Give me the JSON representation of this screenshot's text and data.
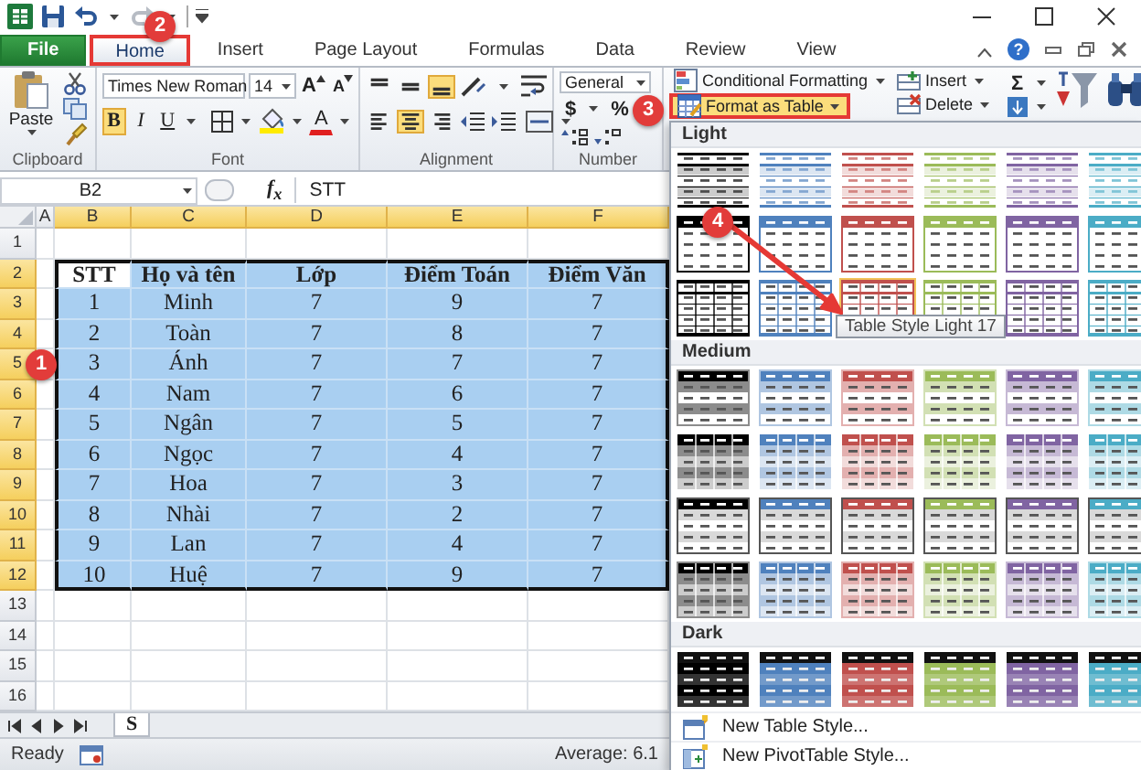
{
  "quick_access": [
    {
      "kind": "save",
      "disabled": false
    },
    {
      "kind": "undo",
      "disabled": false
    },
    {
      "kind": "redo",
      "disabled": true
    }
  ],
  "window": {
    "help": "?"
  },
  "tabs": [
    {
      "label": "File",
      "kind": "file",
      "selected": false,
      "highlighted": false
    },
    {
      "label": "Home",
      "kind": "tab",
      "selected": true,
      "highlighted": true
    },
    {
      "label": "Insert",
      "kind": "tab",
      "selected": false,
      "highlighted": false
    },
    {
      "label": "Page Layout",
      "kind": "tab",
      "selected": false,
      "highlighted": false
    },
    {
      "label": "Formulas",
      "kind": "tab",
      "selected": false,
      "highlighted": false
    },
    {
      "label": "Data",
      "kind": "tab",
      "selected": false,
      "highlighted": false
    },
    {
      "label": "Review",
      "kind": "tab",
      "selected": false,
      "highlighted": false
    },
    {
      "label": "View",
      "kind": "tab",
      "selected": false,
      "highlighted": false
    }
  ],
  "ribbon": {
    "clipboard": {
      "label": "Clipboard",
      "paste": "Paste"
    },
    "font": {
      "label": "Font",
      "font_name": "Times New Roman",
      "font_size": "14",
      "size_buttons": [
        {
          "label": "A",
          "kind": "grow"
        },
        {
          "label": "A",
          "kind": "shrink"
        }
      ],
      "styles": [
        {
          "label": "B",
          "kind": "bold",
          "selected": true
        },
        {
          "label": "I",
          "kind": "italic",
          "selected": false
        },
        {
          "label": "U",
          "kind": "underline",
          "selected": false
        }
      ],
      "font_color": "A"
    },
    "alignment": {
      "label": "Alignment",
      "vertical": [
        {
          "kind": "top",
          "selected": false
        },
        {
          "kind": "middle",
          "selected": false
        },
        {
          "kind": "bottom",
          "selected": true
        }
      ],
      "horizontal": [
        {
          "kind": "left",
          "selected": false
        },
        {
          "kind": "center",
          "selected": true
        },
        {
          "kind": "right",
          "selected": false
        }
      ]
    },
    "number": {
      "label": "Number",
      "format": "General",
      "currency": "$",
      "percent": "%"
    },
    "styles": {
      "buttons": [
        {
          "label": "Conditional Formatting",
          "kind": "conditional",
          "open": false,
          "highlighted": false
        },
        {
          "label": "Format as Table",
          "kind": "table",
          "open": true,
          "highlighted": true
        }
      ]
    },
    "cells": {
      "buttons": [
        {
          "label": "Insert",
          "kind": "insert"
        },
        {
          "label": "Delete",
          "kind": "delete"
        }
      ]
    },
    "editing": {
      "sum": "Σ"
    }
  },
  "formula_bar": {
    "name_box": "B2",
    "function_label": "f$_{x}$",
    "value": "STT"
  },
  "sheet": {
    "columns": [
      {
        "label": "A",
        "selected": false
      },
      {
        "label": "B",
        "selected": true
      },
      {
        "label": "C",
        "selected": true
      },
      {
        "label": "D",
        "selected": true
      },
      {
        "label": "E",
        "selected": true
      },
      {
        "label": "F",
        "selected": true
      }
    ],
    "row_headers": [
      {
        "label": "1",
        "selected": false
      },
      {
        "label": "2",
        "selected": true
      },
      {
        "label": "3",
        "selected": true
      },
      {
        "label": "4",
        "selected": true
      },
      {
        "label": "5",
        "selected": true
      },
      {
        "label": "6",
        "selected": true
      },
      {
        "label": "7",
        "selected": true
      },
      {
        "label": "8",
        "selected": true
      },
      {
        "label": "9",
        "selected": true
      },
      {
        "label": "10",
        "selected": true
      },
      {
        "label": "11",
        "selected": true
      },
      {
        "label": "12",
        "selected": true
      },
      {
        "label": "13",
        "selected": false
      },
      {
        "label": "14",
        "selected": false
      },
      {
        "label": "15",
        "selected": false
      },
      {
        "label": "16",
        "selected": false
      }
    ],
    "table": {
      "selected": true,
      "header": [
        {
          "text": "STT",
          "active": true
        },
        {
          "text": "Họ và tên",
          "active": false
        },
        {
          "text": "Lớp",
          "active": false
        },
        {
          "text": "Điểm Toán",
          "active": false
        },
        {
          "text": "Điểm Văn",
          "active": false
        }
      ],
      "rows": [
        [
          "1",
          "Minh",
          "7",
          "9",
          "7"
        ],
        [
          "2",
          "Toàn",
          "7",
          "8",
          "7"
        ],
        [
          "3",
          "Ánh",
          "7",
          "7",
          "7"
        ],
        [
          "4",
          "Nam",
          "7",
          "6",
          "7"
        ],
        [
          "5",
          "Ngân",
          "7",
          "5",
          "7"
        ],
        [
          "6",
          "Ngọc",
          "7",
          "4",
          "7"
        ],
        [
          "7",
          "Hoa",
          "7",
          "3",
          "7"
        ],
        [
          "8",
          "Nhài",
          "7",
          "2",
          "7"
        ],
        [
          "9",
          "Lan",
          "7",
          "4",
          "7"
        ],
        [
          "10",
          "Huệ",
          "7",
          "9",
          "7"
        ]
      ]
    }
  },
  "sheet_tabs": [
    {
      "label": "S",
      "selected": true
    }
  ],
  "status_bar": {
    "mode": "Ready",
    "summary": "Average: 6.1"
  },
  "gallery": {
    "sections": [
      {
        "title": "Light",
        "rows": [
          {
            "kind": "light-lines",
            "styles": [
              {
                "color": "#000000",
                "selected": false
              },
              {
                "color": "#4f81bd",
                "selected": false
              },
              {
                "color": "#c0504d",
                "selected": false
              },
              {
                "color": "#9bbb59",
                "selected": false
              },
              {
                "color": "#8064a2",
                "selected": false
              },
              {
                "color": "#4bacc6",
                "selected": false
              }
            ]
          },
          {
            "kind": "light-header",
            "styles": [
              {
                "color": "#000000",
                "selected": false
              },
              {
                "color": "#4f81bd",
                "selected": false
              },
              {
                "color": "#c0504d",
                "selected": false
              },
              {
                "color": "#9bbb59",
                "selected": false
              },
              {
                "color": "#8064a2",
                "selected": false
              },
              {
                "color": "#4bacc6",
                "selected": false
              }
            ]
          },
          {
            "kind": "light-grid",
            "styles": [
              {
                "color": "#000000",
                "selected": false
              },
              {
                "color": "#4f81bd",
                "selected": false
              },
              {
                "color": "#c0504d",
                "selected": true
              },
              {
                "color": "#9bbb59",
                "selected": false
              },
              {
                "color": "#8064a2",
                "selected": false
              },
              {
                "color": "#4bacc6",
                "selected": false
              }
            ]
          }
        ]
      },
      {
        "title": "Medium",
        "rows": [
          {
            "kind": "medium-banded",
            "styles": [
              {
                "color": "#000000",
                "selected": false
              },
              {
                "color": "#4f81bd",
                "selected": false
              },
              {
                "color": "#c0504d",
                "selected": false
              },
              {
                "color": "#9bbb59",
                "selected": false
              },
              {
                "color": "#8064a2",
                "selected": false
              },
              {
                "color": "#4bacc6",
                "selected": false
              }
            ]
          },
          {
            "kind": "medium-grid",
            "styles": [
              {
                "color": "#000000",
                "selected": false
              },
              {
                "color": "#4f81bd",
                "selected": false
              },
              {
                "color": "#c0504d",
                "selected": false
              },
              {
                "color": "#9bbb59",
                "selected": false
              },
              {
                "color": "#8064a2",
                "selected": false
              },
              {
                "color": "#4bacc6",
                "selected": false
              }
            ]
          },
          {
            "kind": "medium-grey",
            "styles": [
              {
                "color": "#000000",
                "selected": false
              },
              {
                "color": "#4f81bd",
                "selected": false
              },
              {
                "color": "#c0504d",
                "selected": false
              },
              {
                "color": "#9bbb59",
                "selected": false
              },
              {
                "color": "#8064a2",
                "selected": false
              },
              {
                "color": "#4bacc6",
                "selected": false
              }
            ]
          },
          {
            "kind": "medium-fill",
            "styles": [
              {
                "color": "#000000",
                "selected": false
              },
              {
                "color": "#4f81bd",
                "selected": false
              },
              {
                "color": "#c0504d",
                "selected": false
              },
              {
                "color": "#9bbb59",
                "selected": false
              },
              {
                "color": "#8064a2",
                "selected": false
              },
              {
                "color": "#4bacc6",
                "selected": false
              }
            ]
          }
        ]
      },
      {
        "title": "Dark",
        "rows": [
          {
            "kind": "dark",
            "styles": [
              {
                "color": "#000000",
                "selected": false
              },
              {
                "color": "#4f81bd",
                "selected": false
              },
              {
                "color": "#c0504d",
                "selected": false
              },
              {
                "color": "#9bbb59",
                "selected": false
              },
              {
                "color": "#8064a2",
                "selected": false
              },
              {
                "color": "#4bacc6",
                "selected": false
              }
            ]
          }
        ]
      }
    ],
    "tooltip": "Table Style Light 17",
    "menu_items": [
      {
        "label": "New Table Style...",
        "kind": "table"
      },
      {
        "label": "New PivotTable Style...",
        "kind": "pivot"
      }
    ]
  },
  "annotations": [
    {
      "label": "1"
    },
    {
      "label": "2"
    },
    {
      "label": "3"
    },
    {
      "label": "4"
    }
  ]
}
